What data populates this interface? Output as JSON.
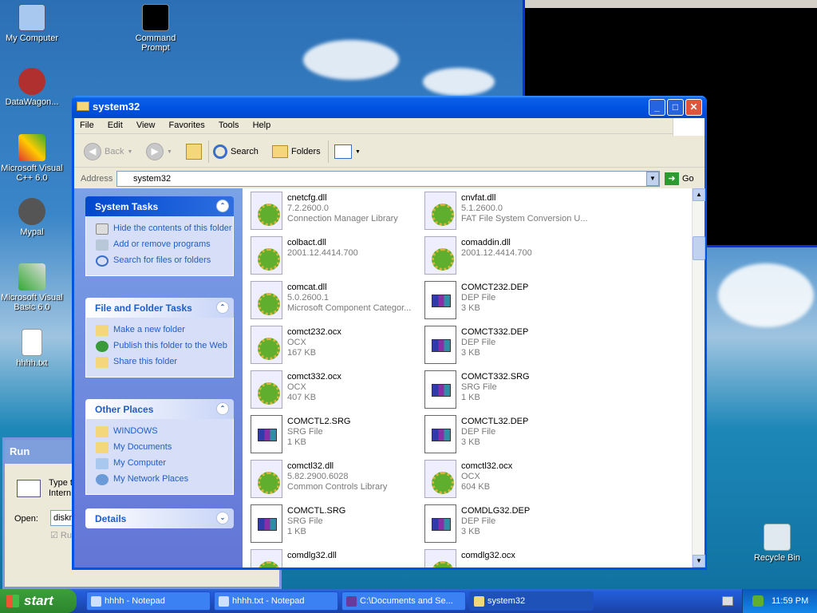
{
  "desktop": {
    "icons": [
      "My Computer",
      "Command Prompt",
      "DataWagon...",
      "Microsoft Visual C++ 6.0",
      "Mypal",
      "Microsoft Visual Basic 6.0",
      "hhhh.txt",
      "Recycle Bin"
    ]
  },
  "run_dialog": {
    "title": "Run",
    "text_line1": "Type t",
    "text_line2": "Intern",
    "open_label": "Open:",
    "open_value": "diskm",
    "checkbox_label": "Ru"
  },
  "window": {
    "title": "system32",
    "menu": [
      "File",
      "Edit",
      "View",
      "Favorites",
      "Tools",
      "Help"
    ],
    "toolbar": {
      "back": "Back",
      "search": "Search",
      "folders": "Folders"
    },
    "address_label": "Address",
    "address_value": "system32",
    "go_label": "Go"
  },
  "tasks": {
    "system_tasks": {
      "title": "System Tasks",
      "items": [
        "Hide the contents of this folder",
        "Add or remove programs",
        "Search for files or folders"
      ]
    },
    "file_tasks": {
      "title": "File and Folder Tasks",
      "items": [
        "Make a new folder",
        "Publish this folder to the Web",
        "Share this folder"
      ]
    },
    "other_places": {
      "title": "Other Places",
      "items": [
        "WINDOWS",
        "My Documents",
        "My Computer",
        "My Network Places"
      ]
    },
    "details": {
      "title": "Details"
    }
  },
  "files": [
    {
      "name": "cnetcfg.dll",
      "l2": "7.2.2600.0",
      "l3": "Connection Manager Library",
      "kind": "dll"
    },
    {
      "name": "cnvfat.dll",
      "l2": "5.1.2600.0",
      "l3": "FAT File System Conversion U...",
      "kind": "dll"
    },
    {
      "name": "colbact.dll",
      "l2": "2001.12.4414.700",
      "l3": "",
      "kind": "dll"
    },
    {
      "name": "comaddin.dll",
      "l2": "2001.12.4414.700",
      "l3": "",
      "kind": "dll"
    },
    {
      "name": "comcat.dll",
      "l2": "5.0.2600.1",
      "l3": "Microsoft Component Categor...",
      "kind": "dll"
    },
    {
      "name": "COMCT232.DEP",
      "l2": "DEP File",
      "l3": "3 KB",
      "kind": "dep"
    },
    {
      "name": "comct232.ocx",
      "l2": "OCX",
      "l3": "167 KB",
      "kind": "dll"
    },
    {
      "name": "COMCT332.DEP",
      "l2": "DEP File",
      "l3": "3 KB",
      "kind": "dep"
    },
    {
      "name": "comct332.ocx",
      "l2": "OCX",
      "l3": "407 KB",
      "kind": "dll"
    },
    {
      "name": "COMCT332.SRG",
      "l2": "SRG File",
      "l3": "1 KB",
      "kind": "dep"
    },
    {
      "name": "COMCTL2.SRG",
      "l2": "SRG File",
      "l3": "1 KB",
      "kind": "dep"
    },
    {
      "name": "COMCTL32.DEP",
      "l2": "DEP File",
      "l3": "3 KB",
      "kind": "dep"
    },
    {
      "name": "comctl32.dll",
      "l2": "5.82.2900.6028",
      "l3": "Common Controls Library",
      "kind": "dll"
    },
    {
      "name": "comctl32.ocx",
      "l2": "OCX",
      "l3": "604 KB",
      "kind": "dll"
    },
    {
      "name": "COMCTL.SRG",
      "l2": "SRG File",
      "l3": "1 KB",
      "kind": "dep"
    },
    {
      "name": "COMDLG32.DEP",
      "l2": "DEP File",
      "l3": "3 KB",
      "kind": "dep"
    },
    {
      "name": "comdlg32.dll",
      "l2": "",
      "l3": "",
      "kind": "dll"
    },
    {
      "name": "comdlg32.ocx",
      "l2": "",
      "l3": "",
      "kind": "dll"
    }
  ],
  "taskbar": {
    "start": "start",
    "items": [
      "hhhh - Notepad",
      "hhhh.txt - Notepad",
      "C:\\Documents and Se...",
      "system32"
    ],
    "clock": "11:59 PM"
  }
}
